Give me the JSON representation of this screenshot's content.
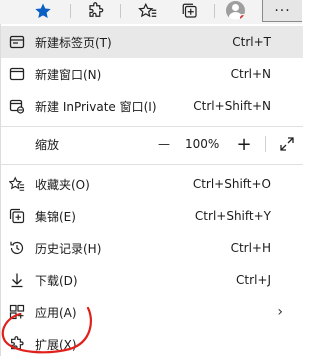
{
  "toolbar": {
    "favorite_icon": "star-icon",
    "extensions_icon": "puzzle-icon",
    "favorites_bar_icon": "favorites-icon",
    "collections_icon": "collections-icon",
    "profile_icon": "avatar",
    "more_label": "···"
  },
  "menu": {
    "new_tab": {
      "label": "新建标签页(T)",
      "shortcut": "Ctrl+T"
    },
    "new_window": {
      "label": "新建窗口(N)",
      "shortcut": "Ctrl+N"
    },
    "new_inprivate": {
      "label": "新建 InPrivate 窗口(I)",
      "shortcut": "Ctrl+Shift+N"
    },
    "zoom": {
      "label": "缩放",
      "minus": "—",
      "value": "100%",
      "plus": "+"
    },
    "favorites": {
      "label": "收藏夹(O)",
      "shortcut": "Ctrl+Shift+O"
    },
    "collections": {
      "label": "集锦(E)",
      "shortcut": "Ctrl+Shift+Y"
    },
    "history": {
      "label": "历史记录(H)",
      "shortcut": "Ctrl+H"
    },
    "downloads": {
      "label": "下载(D)",
      "shortcut": "Ctrl+J"
    },
    "apps": {
      "label": "应用(A)",
      "chevron": "›"
    },
    "extensions": {
      "label": "扩展(X)"
    }
  },
  "colors": {
    "accent_blue": "#0a5fc4",
    "annotation_red": "#e0201b",
    "highlight": "#e8e8e8"
  }
}
